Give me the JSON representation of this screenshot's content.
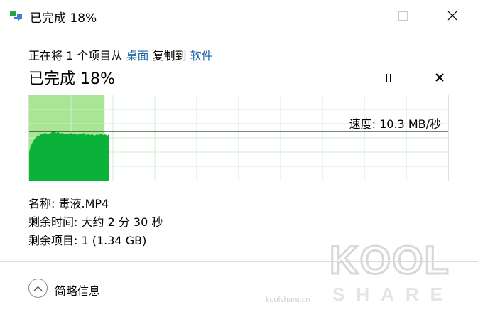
{
  "window": {
    "title": "已完成 18%",
    "icon": "file-copy-icon",
    "controls": [
      "minimize-icon",
      "maximize-icon",
      "close-icon"
    ]
  },
  "operation": {
    "prefix": "正在将 1 个项目从 ",
    "source": "桌面",
    "middle": " 复制到 ",
    "destination": "软件"
  },
  "progress": {
    "label": "已完成 18%",
    "percent": 18,
    "speed_label": "速度: 10.3 MB/秒"
  },
  "details": {
    "name_label": "名称: 毒液.MP4",
    "time_label": "剩余时间: 大约 2 分 30 秒",
    "items_label": "剩余项目: 1 (1.34 GB)"
  },
  "footer": {
    "more_label": "简略信息"
  },
  "watermark": {
    "brand_top": "KOOL",
    "brand_bottom": "SHARE",
    "site": "koolshare.cn"
  },
  "colors": {
    "progress_fill": "#a8e694",
    "speed_graph": "#0ab23a",
    "grid": "#d3ecd3",
    "link": "#1a63a8"
  }
}
